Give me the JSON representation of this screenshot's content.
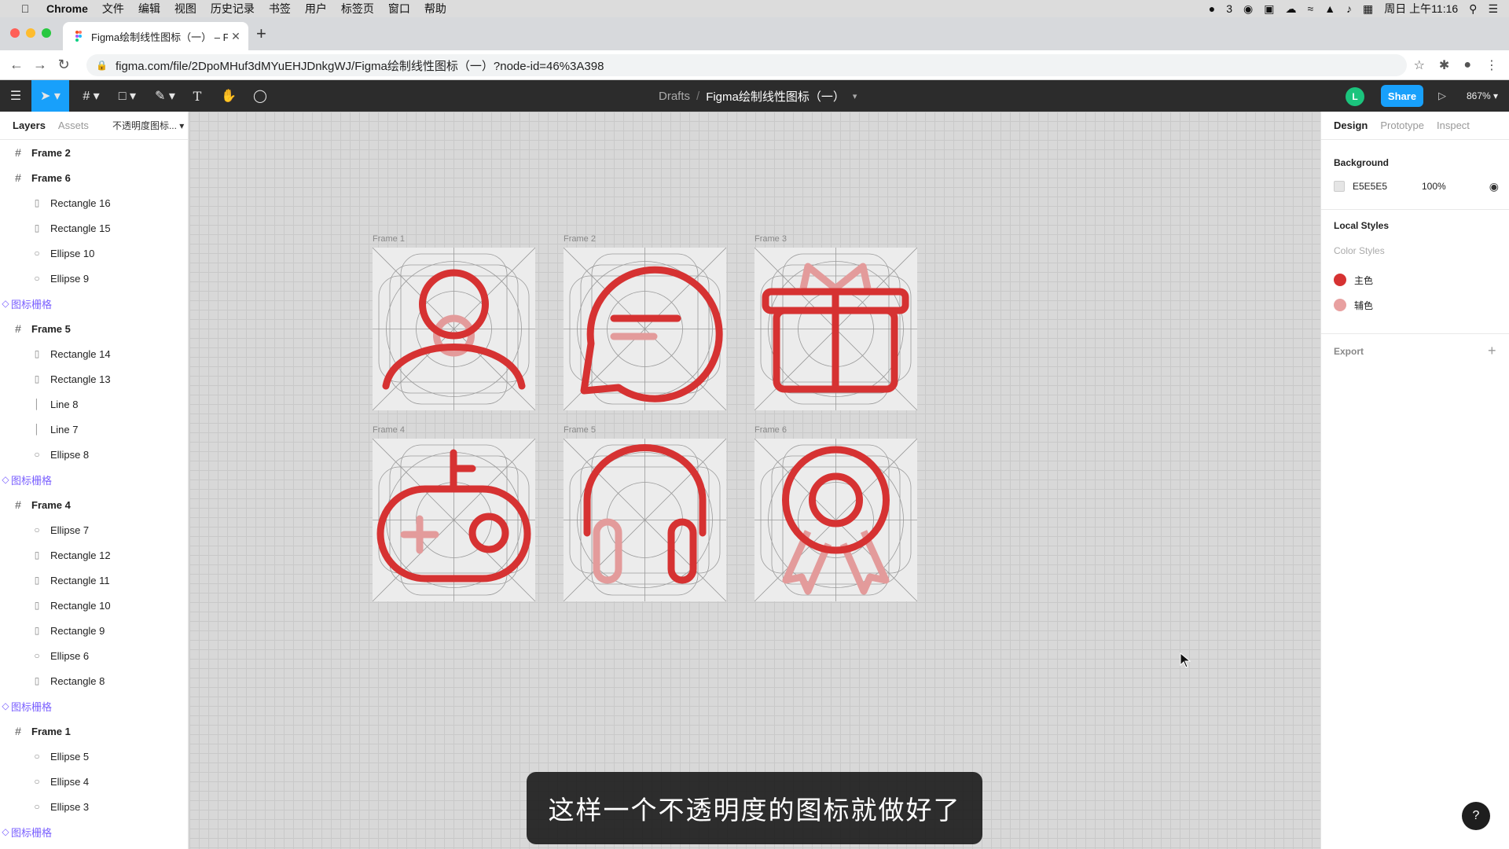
{
  "menubar": {
    "app": "Chrome",
    "items": [
      "文件",
      "编辑",
      "视图",
      "历史记录",
      "书签",
      "用户",
      "标签页",
      "窗口",
      "帮助"
    ],
    "wechat_count": "3",
    "clock": "周日 上午11:16"
  },
  "browser": {
    "tab_title": "Figma绘制线性图标（一） – Fig",
    "url": "figma.com/file/2DpoMHuf3dMYuEHJDnkgWJ/Figma绘制线性图标（一）?node-id=46%3A398"
  },
  "figma_toolbar": {
    "breadcrumb_parent": "Drafts",
    "breadcrumb_sep": "/",
    "file_name": "Figma绘制线性图标（一）",
    "avatar_letter": "L",
    "share_label": "Share",
    "zoom": "867%"
  },
  "left_panel": {
    "tabs": [
      "Layers",
      "Assets"
    ],
    "page": "不透明度图标...",
    "layers": [
      {
        "name": "Frame 2",
        "type": "frame"
      },
      {
        "name": "Frame 6",
        "type": "frame"
      },
      {
        "name": "Rectangle 16",
        "type": "child"
      },
      {
        "name": "Rectangle 15",
        "type": "child"
      },
      {
        "name": "Ellipse 10",
        "type": "child"
      },
      {
        "name": "Ellipse 9",
        "type": "child"
      },
      {
        "name": "图标栅格",
        "type": "comp"
      },
      {
        "name": "Frame 5",
        "type": "frame"
      },
      {
        "name": "Rectangle 14",
        "type": "child"
      },
      {
        "name": "Rectangle 13",
        "type": "child"
      },
      {
        "name": "Line 8",
        "type": "child"
      },
      {
        "name": "Line 7",
        "type": "child"
      },
      {
        "name": "Ellipse 8",
        "type": "child"
      },
      {
        "name": "图标栅格",
        "type": "comp"
      },
      {
        "name": "Frame 4",
        "type": "frame"
      },
      {
        "name": "Ellipse 7",
        "type": "child"
      },
      {
        "name": "Rectangle 12",
        "type": "child"
      },
      {
        "name": "Rectangle 11",
        "type": "child"
      },
      {
        "name": "Rectangle 10",
        "type": "child"
      },
      {
        "name": "Rectangle 9",
        "type": "child"
      },
      {
        "name": "Ellipse 6",
        "type": "child"
      },
      {
        "name": "Rectangle 8",
        "type": "child"
      },
      {
        "name": "图标栅格",
        "type": "comp"
      },
      {
        "name": "Frame 1",
        "type": "frame"
      },
      {
        "name": "Ellipse 5",
        "type": "child"
      },
      {
        "name": "Ellipse 4",
        "type": "child"
      },
      {
        "name": "Ellipse 3",
        "type": "child"
      },
      {
        "name": "图标栅格",
        "type": "comp"
      }
    ]
  },
  "canvas": {
    "frames": [
      "Frame 1",
      "Frame 2",
      "Frame 3",
      "Frame 4",
      "Frame 5",
      "Frame 6"
    ],
    "icons": [
      "user-icon",
      "chat-bubble-icon",
      "gift-icon",
      "gamepad-icon",
      "headphones-icon",
      "award-ribbon-icon"
    ]
  },
  "right_panel": {
    "tabs": [
      "Design",
      "Prototype",
      "Inspect"
    ],
    "background_label": "Background",
    "background_hex": "E5E5E5",
    "background_opacity": "100%",
    "local_styles_label": "Local Styles",
    "color_styles_label": "Color Styles",
    "styles": [
      {
        "name": "主色",
        "color": "#d63232"
      },
      {
        "name": "辅色",
        "color": "#e8a0a0"
      }
    ],
    "export_label": "Export"
  },
  "subtitle": "这样一个不透明度的图标就做好了",
  "colors": {
    "primary": "#d63232",
    "secondary": "#e39b9b",
    "figma_blue": "#18a0fb"
  }
}
